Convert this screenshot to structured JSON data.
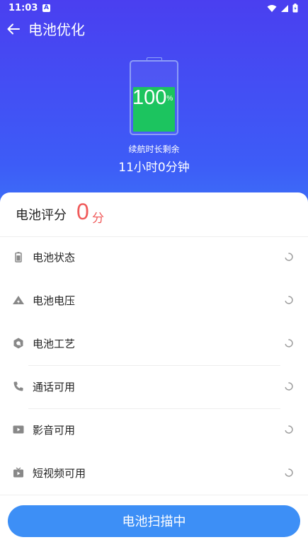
{
  "status_bar": {
    "time": "11:03",
    "notification_letter": "A"
  },
  "header": {
    "title": "电池优化"
  },
  "battery": {
    "percent": "100",
    "percent_unit": "%",
    "level": 1.0,
    "fill_color": "#1cc45f",
    "remaining_label": "续航时长剩余",
    "remaining_value": "11小时0分钟"
  },
  "score": {
    "label": "电池评分",
    "value": "0",
    "unit": "分",
    "color": "#f05a5a"
  },
  "check_items": [
    {
      "label": "电池状态",
      "icon": "battery-small-icon"
    },
    {
      "label": "电池电压",
      "icon": "voltage-triangle-icon"
    },
    {
      "label": "电池工艺",
      "icon": "hexagon-icon"
    },
    {
      "label": "通话可用",
      "icon": "phone-icon"
    },
    {
      "label": "影音可用",
      "icon": "play-icon"
    },
    {
      "label": "短视频可用",
      "icon": "video-icon"
    }
  ],
  "scan_button": {
    "label": "电池扫描中",
    "color": "#3d8ff6"
  },
  "colors": {
    "header_gradient_top": "#4a3ff0",
    "header_gradient_bottom": "#3e8ff6",
    "icon_gray": "#888888",
    "spinner_gray": "#9a9a9a"
  }
}
